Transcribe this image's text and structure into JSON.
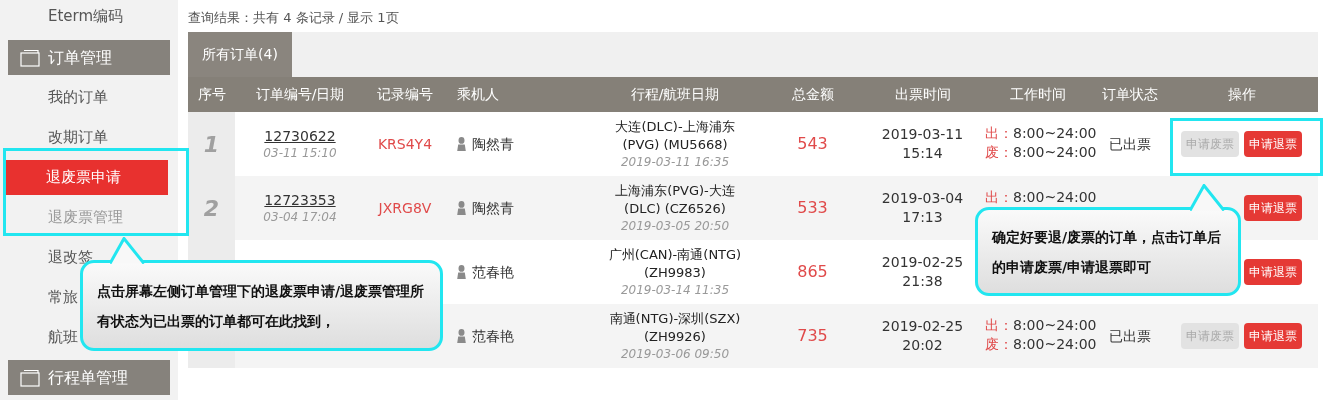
{
  "sidebar": {
    "items": [
      {
        "kind": "item",
        "label": "Eterm编码",
        "selected": false,
        "dimmed": false
      },
      {
        "kind": "header",
        "label": "订单管理"
      },
      {
        "kind": "item",
        "label": "我的订单",
        "selected": false,
        "dimmed": false
      },
      {
        "kind": "item",
        "label": "改期订单",
        "selected": false,
        "dimmed": false
      },
      {
        "kind": "item",
        "label": "退废票申请",
        "selected": true,
        "dimmed": false
      },
      {
        "kind": "item",
        "label": "退废票管理",
        "selected": false,
        "dimmed": true
      },
      {
        "kind": "item",
        "label": "退改签",
        "selected": false,
        "dimmed": false
      },
      {
        "kind": "item",
        "label": "常旅",
        "selected": false,
        "dimmed": false
      },
      {
        "kind": "item",
        "label": "航班",
        "selected": false,
        "dimmed": false
      },
      {
        "kind": "header",
        "label": "行程单管理"
      }
    ]
  },
  "summary": "查询结果：共有 4 条记录 / 显示 1页",
  "tabs": [
    {
      "label": "所有订单(4)",
      "selected": true
    }
  ],
  "table": {
    "columns": [
      "序号",
      "订单编号/日期",
      "记录编号",
      "乘机人",
      "行程/航班日期",
      "总金额",
      "出票时间",
      "工作时间",
      "订单状态",
      "操作"
    ],
    "rows": [
      {
        "seq": "1",
        "order_no": "12730622",
        "order_date": "03-11 15:10",
        "record": "KRS4Y4",
        "passenger": "陶然青",
        "route_lines": [
          "大连(DLC)-上海浦东",
          "(PVG) (MU5668)"
        ],
        "flight_date": "2019-03-11 16:35",
        "amount": "543",
        "issue_lines": [
          "2019-03-11",
          "15:14"
        ],
        "work_time": [
          {
            "label": "出：",
            "hours": "8:00~24:00"
          },
          {
            "label": "废：",
            "hours": "8:00~24:00"
          }
        ],
        "status": "已出票",
        "actions": [
          {
            "kind": "void",
            "label": "申请废票"
          },
          {
            "kind": "refund",
            "label": "申请退票"
          }
        ]
      },
      {
        "seq": "2",
        "order_no": "12723353",
        "order_date": "03-04 17:04",
        "record": "JXRG8V",
        "passenger": "陶然青",
        "route_lines": [
          "上海浦东(PVG)-大连",
          "(DLC) (CZ6526)"
        ],
        "flight_date": "2019-03-05 20:50",
        "amount": "533",
        "issue_lines": [
          "2019-03-04",
          "17:13"
        ],
        "work_time": [
          {
            "label": "出：",
            "hours": "8:00~24:00"
          }
        ],
        "actions": [
          {
            "kind": "refund",
            "label": "申请退票"
          }
        ]
      },
      {
        "passenger": "范春艳",
        "route_lines": [
          "广州(CAN)-南通(NTG)",
          "(ZH9983)"
        ],
        "flight_date": "2019-03-14 11:35",
        "amount": "865",
        "issue_lines": [
          "2019-02-25",
          "21:38"
        ],
        "actions": [
          {
            "kind": "refund",
            "label": "申请退票"
          }
        ]
      },
      {
        "passenger": "范春艳",
        "route_lines": [
          "南通(NTG)-深圳(SZX)",
          "(ZH9926)"
        ],
        "flight_date": "2019-03-06 09:50",
        "amount": "735",
        "issue_lines": [
          "2019-02-25",
          "20:02"
        ],
        "work_time": [
          {
            "label": "出：",
            "hours": "8:00~24:00"
          },
          {
            "label": "废：",
            "hours": "8:00~24:00"
          }
        ],
        "status": "已出票",
        "actions": [
          {
            "kind": "void",
            "label": "申请废票"
          },
          {
            "kind": "refund",
            "label": "申请退票"
          }
        ]
      }
    ]
  },
  "callouts": [
    {
      "text": "点击屏幕左侧订单管理下的退废票申请/退废票管理所有状态为已出票的订单都可在此找到，"
    },
    {
      "text": "确定好要退/废票的订单，点击订单后的申请废票/申请退票即可"
    }
  ]
}
